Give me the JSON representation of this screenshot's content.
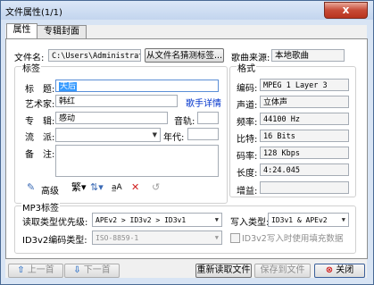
{
  "window": {
    "title": "文件属性(1/1)",
    "close_glyph": "x"
  },
  "tabs": [
    {
      "label": "属性"
    },
    {
      "label": "专辑封面"
    }
  ],
  "file": {
    "filename_label": "文件名:",
    "filename_value": "C:\\Users\\Administrator",
    "guess_button": "从文件名猜测标签...",
    "song_source_label": "歌曲来源:",
    "song_source_value": "本地歌曲"
  },
  "tags": {
    "group_label": "标签",
    "title_label": "标　题:",
    "title_value": "天后",
    "artist_label": "艺术家:",
    "artist_value": "韩红",
    "artist_detail_link": "歌手详情",
    "album_label": "专　辑:",
    "album_value": "感动",
    "track_label": "音轨:",
    "track_value": "",
    "genre_label": "流　派:",
    "genre_value": "",
    "year_label": "年代:",
    "year_value": "",
    "comment_label": "备　注:",
    "comment_value": "",
    "advanced_button": "高级"
  },
  "format": {
    "group_label": "格式",
    "codec_label": "编码:",
    "codec_value": "MPEG 1 Layer 3",
    "channel_label": "声道:",
    "channel_value": "立体声",
    "freq_label": "频率:",
    "freq_value": "44100 Hz",
    "bits_label": "比特:",
    "bits_value": "16 Bits",
    "bitrate_label": "码率:",
    "bitrate_value": "128 Kbps",
    "length_label": "长度:",
    "length_value": "4:24.045",
    "gain_label": "增益:",
    "gain_value": ""
  },
  "mp3tag": {
    "group_label": "MP3标签",
    "read_priority_label": "读取类型优先级:",
    "read_priority_value": "APEv2 > ID3v2 > ID3v1",
    "write_type_label": "写入类型:",
    "write_type_value": "ID3v1 & APEv2",
    "id3v2_encoding_label": "ID3v2编码类型:",
    "id3v2_encoding_value": "ISO-8859-1",
    "pad_checkbox_label": "ID3v2写入时使用填充数据"
  },
  "footer": {
    "prev_button": "上一首",
    "next_button": "下一首",
    "reread_button": "重新读取文件",
    "save_button": "保存到文件",
    "close_button": "关闭"
  }
}
